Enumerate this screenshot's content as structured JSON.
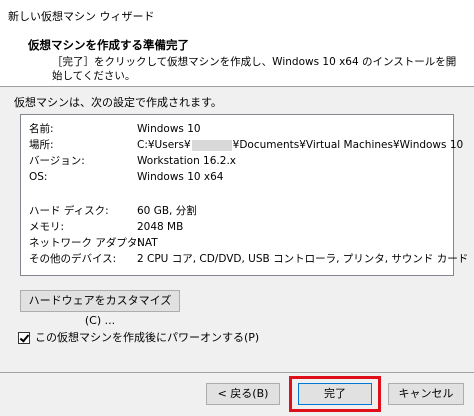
{
  "window": {
    "title": "新しい仮想マシン ウィザード"
  },
  "header": {
    "title": "仮想マシンを作成する準備完了",
    "description": "［完了］をクリックして仮想マシンを作成し、Windows 10 x64 のインストールを開始してください。"
  },
  "intro": "仮想マシンは、次の設定で作成されます。",
  "summary": {
    "name": {
      "label": "名前:",
      "value": "Windows 10"
    },
    "location": {
      "label": "場所:",
      "value_prefix": "C:¥Users¥",
      "value_suffix": "¥Documents¥Virtual Machines¥Windows 10"
    },
    "version": {
      "label": "バージョン:",
      "value": "Workstation 16.2.x"
    },
    "os": {
      "label": "OS:",
      "value": "Windows 10 x64"
    },
    "disk": {
      "label": "ハード ディスク:",
      "value": "60 GB, 分割"
    },
    "memory": {
      "label": "メモリ:",
      "value": "2048 MB"
    },
    "network": {
      "label": "ネットワーク アダプタ:",
      "value": "NAT"
    },
    "devices": {
      "label": "その他のデバイス:",
      "value": "2 CPU コア, CD/DVD, USB コントローラ, プリンタ, サウンド カード"
    }
  },
  "buttons": {
    "customize": "ハードウェアをカスタマイズ(C) ...",
    "back": "< 戻る(B)",
    "finish": "完了",
    "cancel": "キャンセル"
  },
  "power_on": {
    "label": "この仮想マシンを作成後にパワーオンする(P)",
    "checked": true
  },
  "colors": {
    "highlight": "#e0101a",
    "accent": "#0078d7"
  }
}
